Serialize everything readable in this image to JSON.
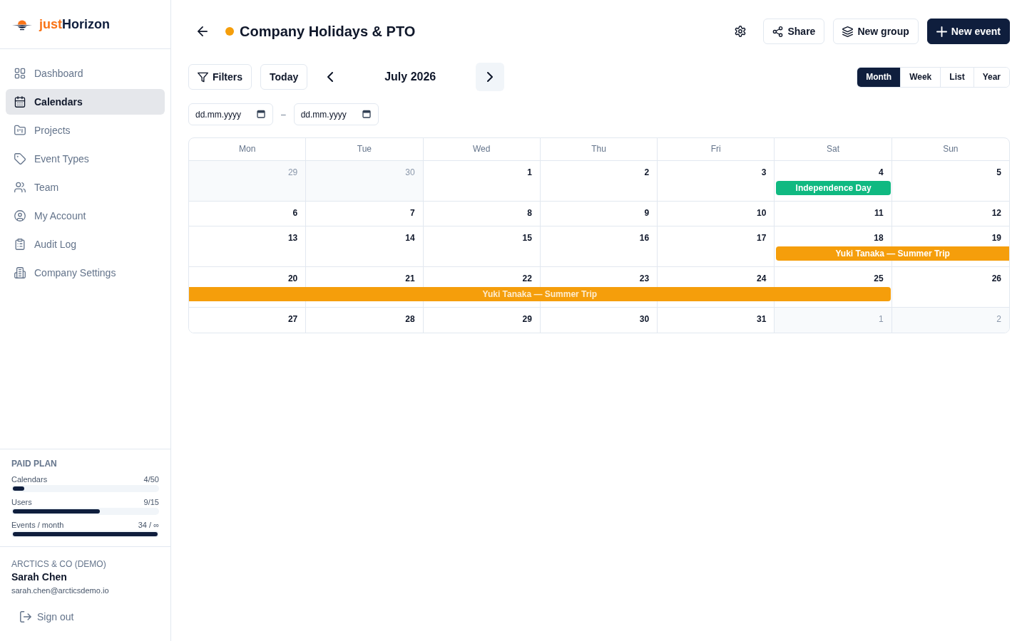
{
  "sidebar": {
    "brand": {
      "accent": "just",
      "name": "Horizon"
    },
    "nav": [
      {
        "label": "Dashboard",
        "selected": false
      },
      {
        "label": "Calendars",
        "selected": true
      },
      {
        "label": "Projects",
        "selected": false
      },
      {
        "label": "Event Types",
        "selected": false
      },
      {
        "label": "Team",
        "selected": false
      },
      {
        "label": "My Account",
        "selected": false
      },
      {
        "label": "Audit Log",
        "selected": false
      },
      {
        "label": "Company Settings",
        "selected": false
      }
    ],
    "plan": {
      "title": "PAID PLAN",
      "meters": [
        {
          "label": "Calendars",
          "reading": "4/50",
          "level": 0.08
        },
        {
          "label": "Users",
          "reading": "9/15",
          "level": 0.6
        },
        {
          "label": "Events / month",
          "reading": "34 / ∞",
          "level": 1
        }
      ]
    },
    "account": {
      "company": "ARCTICS & CO (DEMO)",
      "user": "Sarah Chen",
      "email": "sarah.chen@arcticsdemo.io",
      "sign_out": "Sign out"
    }
  },
  "header": {
    "title": "Company Holidays & PTO",
    "color": "#f59e0b",
    "actions": [
      {
        "kind": "icon"
      },
      {
        "kind": "outline",
        "label": "Share"
      },
      {
        "kind": "outline",
        "label": "New group"
      },
      {
        "kind": "primary",
        "label": "New event"
      }
    ]
  },
  "toolbar": {
    "filters": "Filters",
    "today": "Today",
    "period": "July 2026",
    "steppers": [
      {
        "kind": "prev",
        "hovered": false
      },
      {
        "kind": "next",
        "hovered": true
      }
    ],
    "views": [
      {
        "label": "Month",
        "selected": true
      },
      {
        "label": "Week",
        "selected": false
      },
      {
        "label": "List",
        "selected": false
      },
      {
        "label": "Year",
        "selected": false
      }
    ]
  },
  "date_range": {
    "from": {
      "placeholder": "dd.mm.yyyy"
    },
    "separator": "–",
    "to": {
      "placeholder": "dd.mm.yyyy"
    }
  },
  "calendar": {
    "weekdays": [
      "Mon",
      "Tue",
      "Wed",
      "Thu",
      "Fri",
      "Sat",
      "Sun"
    ],
    "weeks": [
      {
        "days": [
          {
            "label": "29",
            "outside": true
          },
          {
            "label": "30",
            "outside": true
          },
          {
            "label": "1",
            "outside": false
          },
          {
            "label": "2",
            "outside": false
          },
          {
            "label": "3",
            "outside": false
          },
          {
            "label": "4",
            "outside": false
          },
          {
            "label": "5",
            "outside": false
          }
        ],
        "events": [
          {
            "title": "Independence Day",
            "color": "#10b981",
            "covers": [
              false,
              false,
              false,
              false,
              false,
              true,
              false
            ],
            "continues_before": false,
            "continues_after": false
          }
        ]
      },
      {
        "days": [
          {
            "label": "6",
            "outside": false
          },
          {
            "label": "7",
            "outside": false
          },
          {
            "label": "8",
            "outside": false
          },
          {
            "label": "9",
            "outside": false
          },
          {
            "label": "10",
            "outside": false
          },
          {
            "label": "11",
            "outside": false
          },
          {
            "label": "12",
            "outside": false
          }
        ]
      },
      {
        "days": [
          {
            "label": "13",
            "outside": false
          },
          {
            "label": "14",
            "outside": false
          },
          {
            "label": "15",
            "outside": false
          },
          {
            "label": "16",
            "outside": false
          },
          {
            "label": "17",
            "outside": false
          },
          {
            "label": "18",
            "outside": false
          },
          {
            "label": "19",
            "outside": false
          }
        ],
        "events": [
          {
            "title": "Yuki Tanaka — Summer Trip",
            "color": "#f59e0b",
            "covers": [
              false,
              false,
              false,
              false,
              false,
              true,
              true
            ],
            "continues_before": false,
            "continues_after": true
          }
        ]
      },
      {
        "days": [
          {
            "label": "20",
            "outside": false
          },
          {
            "label": "21",
            "outside": false
          },
          {
            "label": "22",
            "outside": false
          },
          {
            "label": "23",
            "outside": false
          },
          {
            "label": "24",
            "outside": false
          },
          {
            "label": "25",
            "outside": false
          },
          {
            "label": "26",
            "outside": false
          }
        ],
        "events": [
          {
            "title": "Yuki Tanaka — Summer Trip",
            "color": "#f59e0b",
            "covers": [
              true,
              true,
              true,
              true,
              true,
              true,
              false
            ],
            "continues_before": true,
            "continues_after": false
          }
        ]
      },
      {
        "days": [
          {
            "label": "27",
            "outside": false
          },
          {
            "label": "28",
            "outside": false
          },
          {
            "label": "29",
            "outside": false
          },
          {
            "label": "30",
            "outside": false
          },
          {
            "label": "31",
            "outside": false
          },
          {
            "label": "1",
            "outside": true
          },
          {
            "label": "2",
            "outside": true
          }
        ]
      }
    ]
  }
}
